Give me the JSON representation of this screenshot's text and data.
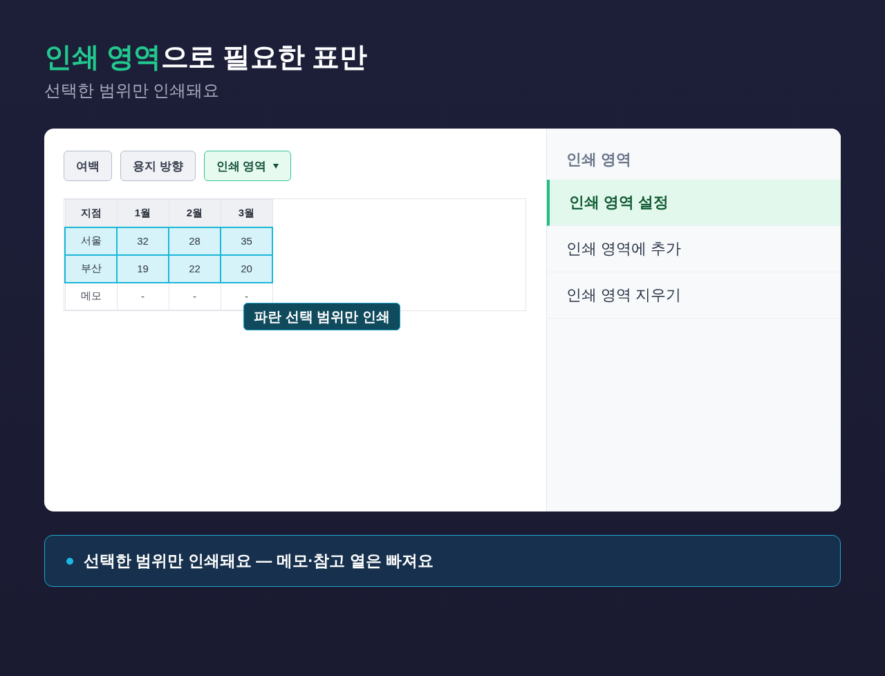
{
  "heading": {
    "title": [
      {
        "text": "인쇄 영역",
        "accent": true
      },
      {
        "text": "으로 필요한 표만",
        "accent": false
      }
    ],
    "subtitle": "선택한 범위만 인쇄돼요"
  },
  "toolbar": {
    "buttons": [
      {
        "label": "여백",
        "kind": "button",
        "selected": false
      },
      {
        "label": "용지 방향",
        "kind": "button",
        "selected": false
      },
      {
        "label": "인쇄 영역",
        "kind": "dropdown",
        "selected": true
      }
    ]
  },
  "sheet": {
    "columns": [
      "지점",
      "1월",
      "2월",
      "3월"
    ],
    "rows": [
      {
        "cells": [
          "서울",
          "32",
          "28",
          "35"
        ],
        "selected": true
      },
      {
        "cells": [
          "부산",
          "19",
          "22",
          "20"
        ],
        "selected": true
      },
      {
        "cells": [
          "메모",
          "-",
          "-",
          "-"
        ],
        "selected": false
      }
    ],
    "tooltip": "파란 선택 범위만 인쇄"
  },
  "menu": {
    "title": "인쇄 영역",
    "items": [
      {
        "label": "인쇄 영역 설정",
        "selected": true
      },
      {
        "label": "인쇄 영역에 추가",
        "selected": false
      },
      {
        "label": "인쇄 영역 지우기",
        "selected": false
      }
    ]
  },
  "callout": {
    "text": "선택한 범위만 인쇄돼요 — 메모·참고 열은 빠져요"
  }
}
